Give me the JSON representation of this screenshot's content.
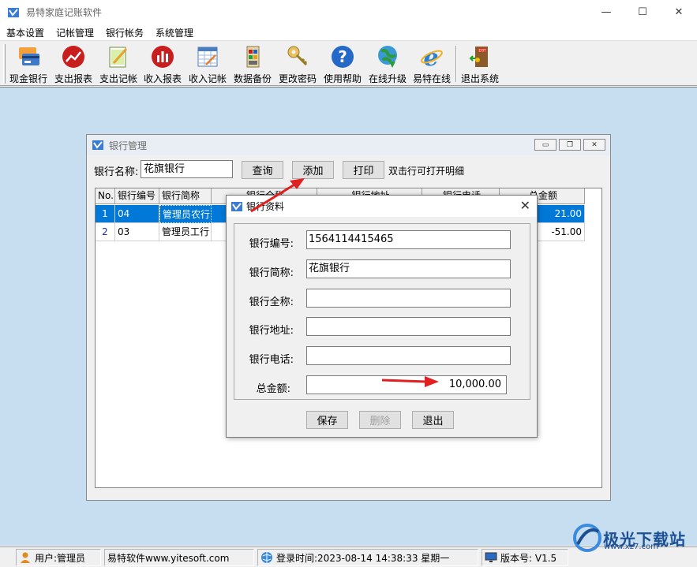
{
  "app": {
    "title": "易特家庭记账软件",
    "window_controls": {
      "minimize": "—",
      "maximize": "☐",
      "close": "✕"
    }
  },
  "menu": [
    "基本设置",
    "记帐管理",
    "银行帐务",
    "系统管理"
  ],
  "toolbar": [
    {
      "label": "现金银行",
      "icon": "bank-card-icon"
    },
    {
      "label": "支出报表",
      "icon": "line-chart-icon"
    },
    {
      "label": "支出记帐",
      "icon": "ledger-pencil-icon"
    },
    {
      "label": "收入报表",
      "icon": "bar-chart-icon"
    },
    {
      "label": "收入记帐",
      "icon": "spreadsheet-icon"
    },
    {
      "label": "数据备份",
      "icon": "database-icon"
    },
    {
      "label": "更改密码",
      "icon": "key-icon"
    },
    {
      "label": "使用帮助",
      "icon": "help-icon"
    },
    {
      "label": "在线升级",
      "icon": "globe-update-icon"
    },
    {
      "label": "易特在线",
      "icon": "internet-explorer-icon"
    },
    {
      "label": "退出系统",
      "icon": "exit-door-icon"
    }
  ],
  "bank_window": {
    "title": "银行管理",
    "controls": {
      "minimize": "▭",
      "restore": "❐",
      "close": "✕"
    },
    "name_label": "银行名称:",
    "name_value": "花旗银行",
    "buttons": {
      "query": "查询",
      "add": "添加",
      "print": "打印"
    },
    "hint": "双击行可打开明细",
    "columns": [
      "No.",
      "银行编号",
      "银行简称",
      "银行全称",
      "银行地址",
      "银行电话",
      "总金额"
    ],
    "rows": [
      {
        "no": "1",
        "code": "04",
        "short": "管理员农行",
        "amount": "21.00",
        "selected": true
      },
      {
        "no": "2",
        "code": "03",
        "short": "管理员工行",
        "amount": "-51.00",
        "selected": false
      }
    ]
  },
  "dialog": {
    "title": "银行资料",
    "close": "✕",
    "fields": [
      {
        "label": "银行编号:",
        "value": "1564114415465"
      },
      {
        "label": "银行简称:",
        "value": "花旗银行"
      },
      {
        "label": "银行全称:",
        "value": ""
      },
      {
        "label": "银行地址:",
        "value": ""
      },
      {
        "label": "银行电话:",
        "value": ""
      },
      {
        "label": "总金额:",
        "value": "10,000.00"
      }
    ],
    "buttons": {
      "save": "保存",
      "delete": "删除",
      "exit": "退出"
    }
  },
  "statusbar": {
    "user": "用户:管理员",
    "company": "易特软件www.yitesoft.com",
    "login": "登录时间:2023-08-14 14:38:33 星期一",
    "version": "版本号: V1.5"
  },
  "watermark": {
    "text": "极光下载站",
    "url": "www.xz7.com"
  },
  "colors": {
    "mdi_background": "#c7def0",
    "selection": "#0078d7",
    "annotation_arrow": "#e02020"
  }
}
